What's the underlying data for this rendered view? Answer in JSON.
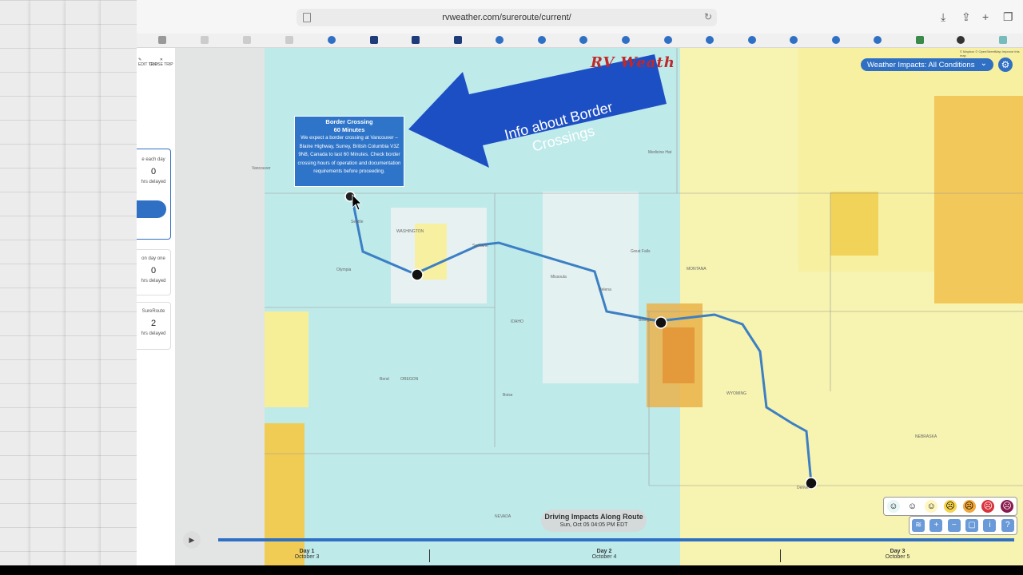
{
  "browser": {
    "url": "rvweather.com/sureroute/current/"
  },
  "trip_toolbar": {
    "edit_label": "EDIT TRIP",
    "close_label": "CLOSE TRIP"
  },
  "sidebar": {
    "cards": [
      {
        "title": "e each day",
        "value": "0",
        "sub": "hrs delayed"
      },
      {
        "title": "on day one",
        "value": "0",
        "sub": "hrs delayed"
      },
      {
        "title": "SureRoute",
        "value": "2",
        "sub": "hrs delayed"
      }
    ]
  },
  "map": {
    "logo_text": "RV Weath",
    "impacts_select": "Weather Impacts: All Conditions",
    "attribution": "© Mapbox © OpenStreetMap  Improve this map",
    "tooltip": {
      "title": "Border Crossing",
      "duration": "60 Minutes",
      "body": "We expect a border crossing at Vancouver – Blaine Highway, Surrey, British Columbia V3Z 9N8, Canada to last 60 Minutes. Check border crossing hours of operation and documentation requirements before proceeding."
    },
    "annotation_arrow": "Info about Border Crossings",
    "states": [
      "WASHINGTON",
      "OREGON",
      "MONTANA",
      "WYOMING",
      "NEBRASKA",
      "NEVADA",
      "IDAHO"
    ],
    "cities": [
      "Vancouver",
      "Seattle",
      "Olympia",
      "Spokane",
      "Great Falls",
      "Billings",
      "Boise",
      "Bend",
      "Denver",
      "Medicine Hat",
      "Missoula",
      "Helena"
    ]
  },
  "route_panel": {
    "title": "Driving Impacts Along Route",
    "time": "Sun, Oct 05 04:05 PM EDT"
  },
  "timeline": {
    "days": [
      {
        "label": "Day 1",
        "date": "October 3"
      },
      {
        "label": "Day 2",
        "date": "October 4"
      },
      {
        "label": "Day 3",
        "date": "October 5"
      }
    ]
  },
  "colors": {
    "accent": "#2f70c4",
    "arrow": "#1d4fc4",
    "yellow_light": "#f7f0a0",
    "yellow_mid": "#f2d35a",
    "orange": "#e9a23a",
    "cyan": "#bfeaea"
  }
}
